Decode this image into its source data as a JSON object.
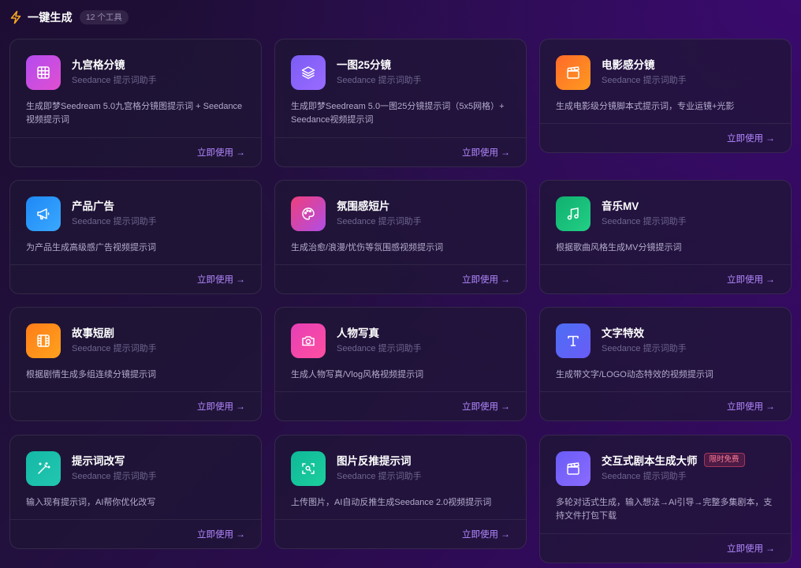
{
  "header": {
    "icon": "lightning-bolt-icon",
    "title": "一键生成",
    "count": "12 个工具"
  },
  "colors": {
    "accent_link": "#b388ff",
    "bolt": "#f5a623"
  },
  "cards": [
    {
      "name": "九宫格分镜",
      "subtitle": "Seedance 提示词助手",
      "desc": "生成即梦Seedream 5.0九宫格分镜图提示词 + Seedance视频提示词",
      "action": "立即使用",
      "icon": "grid-icon",
      "gradient": [
        "#b44bf0",
        "#e04fd0"
      ]
    },
    {
      "name": "一图25分镜",
      "subtitle": "Seedance 提示词助手",
      "desc": "生成即梦Seedream 5.0一图25分镜提示词（5x5网格）+ Seedance视频提示词",
      "action": "立即使用",
      "icon": "layers-icon",
      "gradient": [
        "#7b5cf5",
        "#9a6bff"
      ]
    },
    {
      "name": "电影感分镜",
      "subtitle": "Seedance 提示词助手",
      "desc": "生成电影级分镜脚本式提示词，专业运镜+光影",
      "action": "立即使用",
      "icon": "clapperboard-icon",
      "gradient": [
        "#ff6a2a",
        "#ff9a1f"
      ]
    },
    {
      "name": "产品广告",
      "subtitle": "Seedance 提示词助手",
      "desc": "为产品生成高级感广告视频提示词",
      "action": "立即使用",
      "icon": "megaphone-icon",
      "gradient": [
        "#1e88f5",
        "#3aa8ff"
      ]
    },
    {
      "name": "氛围感短片",
      "subtitle": "Seedance 提示词助手",
      "desc": "生成治愈/浪漫/忧伤等氛围感视频提示词",
      "action": "立即使用",
      "icon": "palette-icon",
      "gradient": [
        "#ef3f7c",
        "#b04ee6"
      ]
    },
    {
      "name": "音乐MV",
      "subtitle": "Seedance 提示词助手",
      "desc": "根据歌曲风格生成MV分镜提示词",
      "action": "立即使用",
      "icon": "music-note-icon",
      "gradient": [
        "#10b070",
        "#22cf85"
      ]
    },
    {
      "name": "故事短剧",
      "subtitle": "Seedance 提示词助手",
      "desc": "根据剧情生成多组连续分镜提示词",
      "action": "立即使用",
      "icon": "film-icon",
      "gradient": [
        "#ff7d1a",
        "#ffa21c"
      ]
    },
    {
      "name": "人物写真",
      "subtitle": "Seedance 提示词助手",
      "desc": "生成人物写真/Vlog风格视频提示词",
      "action": "立即使用",
      "icon": "camera-icon",
      "gradient": [
        "#e63fb6",
        "#ff4fa0"
      ]
    },
    {
      "name": "文字特效",
      "subtitle": "Seedance 提示词助手",
      "desc": "生成带文字/LOGO动态特效的视频提示词",
      "action": "立即使用",
      "icon": "text-t-icon",
      "gradient": [
        "#4c6ef5",
        "#6a5cf6"
      ]
    },
    {
      "name": "提示词改写",
      "subtitle": "Seedance 提示词助手",
      "desc": "输入现有提示词，AI帮你优化改写",
      "action": "立即使用",
      "icon": "magic-wand-icon",
      "gradient": [
        "#14b8a6",
        "#22c7b0"
      ]
    },
    {
      "name": "图片反推提示词",
      "subtitle": "Seedance 提示词助手",
      "desc": "上传图片，AI自动反推生成Seedance 2.0视频提示词",
      "action": "立即使用",
      "icon": "scan-search-icon",
      "gradient": [
        "#0fb89a",
        "#1ccf9c"
      ]
    },
    {
      "name": "交互式剧本生成大师",
      "subtitle": "Seedance 提示词助手",
      "desc": "多轮对话式生成，输入想法→AI引导→完整多集剧本，支持文件打包下载",
      "action": "立即使用",
      "icon": "clapperboard-icon",
      "gradient": [
        "#6a5cf6",
        "#8b6bff"
      ],
      "badge": "限时免费"
    }
  ]
}
